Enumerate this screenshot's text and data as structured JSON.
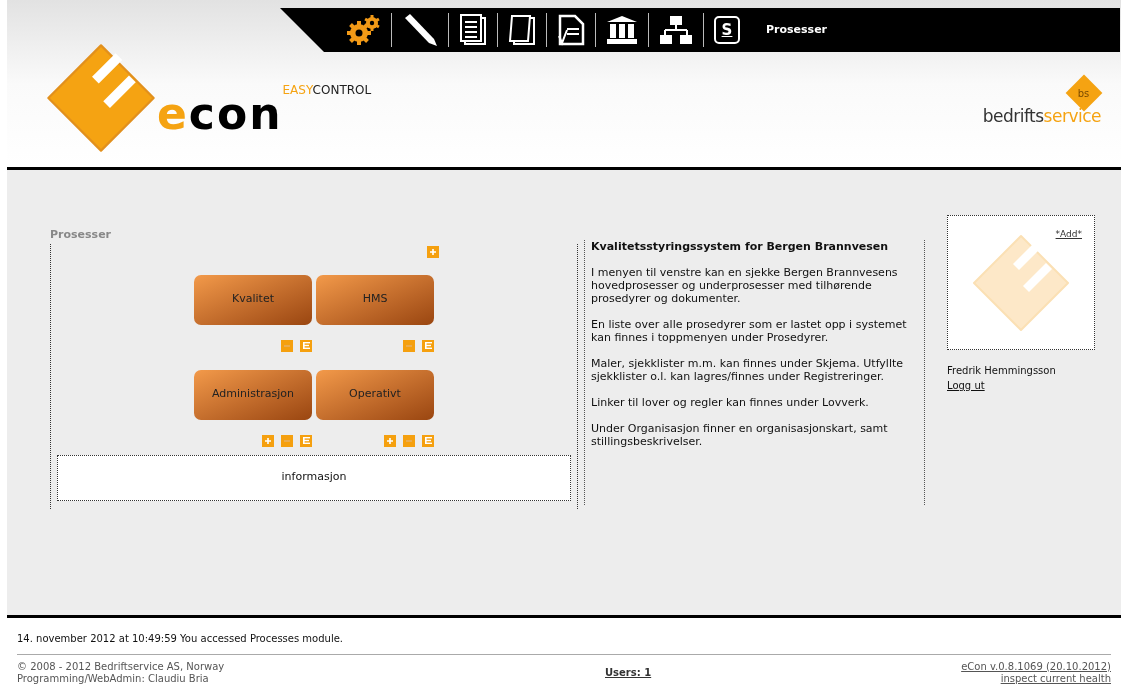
{
  "toolbar": {
    "items": [
      {
        "kind": "gears"
      },
      {
        "kind": "pencil"
      },
      {
        "kind": "document"
      },
      {
        "kind": "page"
      },
      {
        "kind": "checklist"
      },
      {
        "kind": "building"
      },
      {
        "kind": "org-chart"
      },
      {
        "kind": "letter",
        "label": "S"
      }
    ],
    "title": "Prosesser"
  },
  "logo": {
    "accent": "e",
    "rest": "con",
    "tagline_accent": "EASY",
    "tagline_rest": "CONTROL"
  },
  "partner_logo": {
    "badge": "bs",
    "dark": "bedrifts",
    "accent": "service"
  },
  "processes": {
    "title": "Prosesser",
    "top_actions": [
      {
        "kind": "add"
      }
    ],
    "rows": [
      {
        "boxes": [
          {
            "label": "Kvalitet",
            "actions": [
              {
                "kind": "remove"
              },
              {
                "kind": "edit"
              }
            ]
          },
          {
            "label": "HMS",
            "actions": [
              {
                "kind": "remove"
              },
              {
                "kind": "edit"
              }
            ]
          }
        ]
      },
      {
        "boxes": [
          {
            "label": "Administrasjon",
            "actions": [
              {
                "kind": "add"
              },
              {
                "kind": "remove"
              },
              {
                "kind": "edit"
              }
            ]
          },
          {
            "label": "Operativt",
            "actions": [
              {
                "kind": "add"
              },
              {
                "kind": "remove"
              },
              {
                "kind": "edit"
              }
            ]
          }
        ]
      }
    ],
    "info": "informasjon"
  },
  "article": {
    "heading": "Kvalitetsstyringssystem for Bergen Brannvesen",
    "paragraphs": [
      "I menyen til venstre kan en sjekke Bergen Brannvesens hovedprosesser og underprosesser med tilhørende prosedyrer og dokumenter.",
      "En liste over alle prosedyrer som er lastet opp i systemet kan finnes i toppmenyen under Prosedyrer.",
      "Maler, sjekklister m.m. kan finnes under Skjema. Utfyllte sjekklister o.l. kan lagres/finnes under Registreringer.",
      "Linker til lover og regler kan finnes under Lovverk.",
      "Under Organisasjon finner en organisasjonskart, samt stillingsbeskrivelser."
    ]
  },
  "user": {
    "add_link": "*Add*",
    "name": "Fredrik Hemmingsson",
    "logout": "Logg ut"
  },
  "status_message": "14. november 2012 at 10:49:59 You accessed Processes module.",
  "footer": {
    "copyright": "© 2008 - 2012 Bedriftservice AS, Norway",
    "credits": "Programming/WebAdmin: Claudiu Bria",
    "users": "Users: 1",
    "version": "eCon v.0.8.1069 (20.10.2012)",
    "health": "inspect current health"
  }
}
